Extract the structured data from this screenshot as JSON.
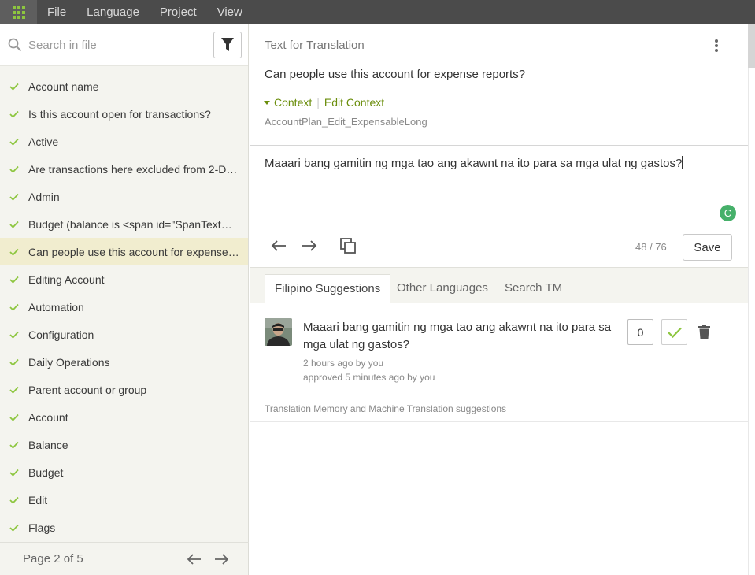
{
  "menu": {
    "items": [
      "File",
      "Language",
      "Project",
      "View"
    ]
  },
  "sidebar": {
    "search_placeholder": "Search in file",
    "items": [
      {
        "label": "Account name"
      },
      {
        "label": "Is this account open for transactions?"
      },
      {
        "label": "Active"
      },
      {
        "label": "Are transactions here excluded from 2-D r..."
      },
      {
        "label": "Admin"
      },
      {
        "label": "Budget (balance is <span id=\"SpanTextCur..."
      },
      {
        "label": "Can people use this account for expense r..."
      },
      {
        "label": "Editing Account"
      },
      {
        "label": "Automation"
      },
      {
        "label": "Configuration"
      },
      {
        "label": "Daily Operations"
      },
      {
        "label": "Parent account or group"
      },
      {
        "label": "Account"
      },
      {
        "label": "Balance"
      },
      {
        "label": "Budget"
      },
      {
        "label": "Edit"
      },
      {
        "label": "Flags"
      }
    ],
    "active_index": 6,
    "pager_label": "Page 2 of 5"
  },
  "editor": {
    "section_title": "Text for Translation",
    "source_text": "Can people use this account for expense reports?",
    "context_label": "Context",
    "edit_context_label": "Edit Context",
    "context_key": "AccountPlan_Edit_ExpensableLong",
    "translation_text": "Maaari bang gamitin ng mga tao ang akawnt na ito para sa mga ulat ng gastos?",
    "spinner_glyph": "C",
    "char_count": "48 / 76",
    "save_label": "Save"
  },
  "tabs": [
    {
      "label": "Filipino Suggestions"
    },
    {
      "label": "Other Languages"
    },
    {
      "label": "Search TM"
    }
  ],
  "suggestion": {
    "text": "Maaari bang gamitin ng mga tao ang akawnt na ito para sa mga ulat ng gastos?",
    "time_text": "2 hours ago by you",
    "approved_text": "approved 5 minutes ago by you",
    "votes": "0"
  },
  "tm_header": "Translation Memory and Machine Translation suggestions",
  "colors": {
    "accent_green": "#8dc63f",
    "context_green": "#6b8e0c",
    "active_row": "#f1edcf",
    "topbar": "#4b4b4b"
  }
}
